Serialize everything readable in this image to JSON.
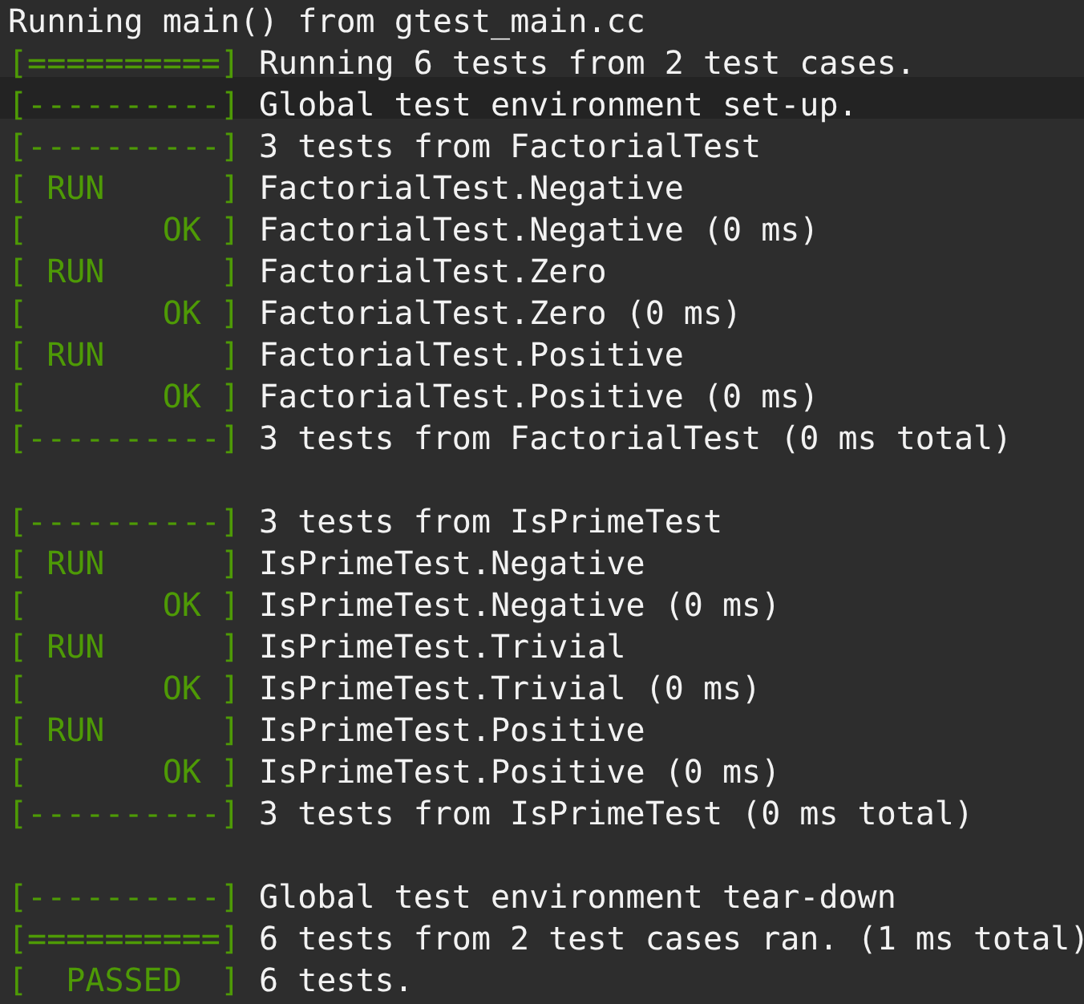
{
  "terminal": {
    "lines": [
      {
        "kind": "plain",
        "text": "Running main() from gtest_main.cc"
      },
      {
        "kind": "tagged",
        "tag": "[==========]",
        "text": "Running 6 tests from 2 test cases."
      },
      {
        "kind": "tagged",
        "tag": "[----------]",
        "text": "Global test environment set-up."
      },
      {
        "kind": "tagged",
        "tag": "[----------]",
        "text": "3 tests from FactorialTest"
      },
      {
        "kind": "tagged",
        "tag": "[ RUN      ]",
        "text": "FactorialTest.Negative"
      },
      {
        "kind": "tagged",
        "tag": "[       OK ]",
        "text": "FactorialTest.Negative (0 ms)"
      },
      {
        "kind": "tagged",
        "tag": "[ RUN      ]",
        "text": "FactorialTest.Zero"
      },
      {
        "kind": "tagged",
        "tag": "[       OK ]",
        "text": "FactorialTest.Zero (0 ms)"
      },
      {
        "kind": "tagged",
        "tag": "[ RUN      ]",
        "text": "FactorialTest.Positive"
      },
      {
        "kind": "tagged",
        "tag": "[       OK ]",
        "text": "FactorialTest.Positive (0 ms)"
      },
      {
        "kind": "tagged",
        "tag": "[----------]",
        "text": "3 tests from FactorialTest (0 ms total)"
      },
      {
        "kind": "blank"
      },
      {
        "kind": "tagged",
        "tag": "[----------]",
        "text": "3 tests from IsPrimeTest"
      },
      {
        "kind": "tagged",
        "tag": "[ RUN      ]",
        "text": "IsPrimeTest.Negative"
      },
      {
        "kind": "tagged",
        "tag": "[       OK ]",
        "text": "IsPrimeTest.Negative (0 ms)"
      },
      {
        "kind": "tagged",
        "tag": "[ RUN      ]",
        "text": "IsPrimeTest.Trivial"
      },
      {
        "kind": "tagged",
        "tag": "[       OK ]",
        "text": "IsPrimeTest.Trivial (0 ms)"
      },
      {
        "kind": "tagged",
        "tag": "[ RUN      ]",
        "text": "IsPrimeTest.Positive"
      },
      {
        "kind": "tagged",
        "tag": "[       OK ]",
        "text": "IsPrimeTest.Positive (0 ms)"
      },
      {
        "kind": "tagged",
        "tag": "[----------]",
        "text": "3 tests from IsPrimeTest (0 ms total)"
      },
      {
        "kind": "blank"
      },
      {
        "kind": "tagged",
        "tag": "[----------]",
        "text": "Global test environment tear-down"
      },
      {
        "kind": "tagged",
        "tag": "[==========]",
        "text": "6 tests from 2 test cases ran. (1 ms total)"
      },
      {
        "kind": "tagged",
        "tag": "[  PASSED  ]",
        "text": "6 tests."
      }
    ]
  }
}
